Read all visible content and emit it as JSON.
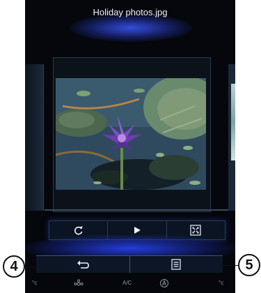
{
  "header": {
    "title": "Holiday photos.jpg"
  },
  "controls": [
    {
      "name": "rotate-button",
      "icon": "rotate-icon"
    },
    {
      "name": "play-button",
      "icon": "play-icon"
    },
    {
      "name": "fullscreen-button",
      "icon": "fullscreen-icon"
    }
  ],
  "bottom_bar": {
    "back_icon": "back-arrow-icon",
    "menu_icon": "list-menu-icon"
  },
  "climate_bar": {
    "left_temp_unit": "°c",
    "fan_icon": "fan-icon",
    "ac_label": "A/C",
    "auto_icon": "auto-climate-icon",
    "right_temp_unit": "°c"
  },
  "callouts": {
    "left": "4",
    "right": "5"
  },
  "colors": {
    "screen_bg": "#05070c",
    "glow": "#3c5aff",
    "icon": "#f2f4ff"
  }
}
